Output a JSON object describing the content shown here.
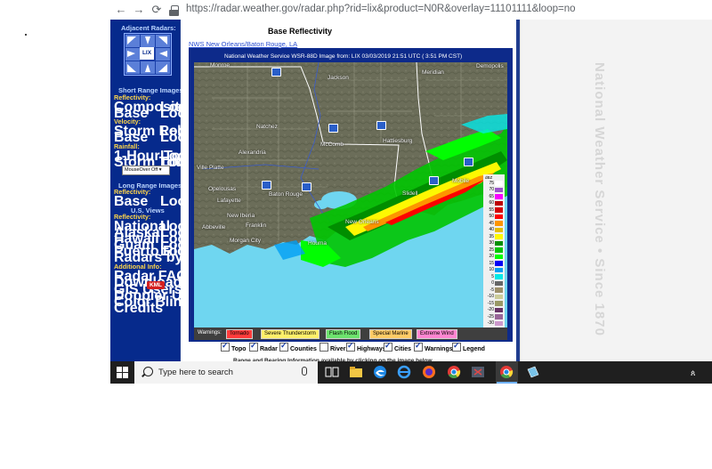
{
  "browser": {
    "url": "https://radar.weather.gov/radar.php?rid=lix&product=N0R&overlay=11101111&loop=no",
    "icons": [
      "back-arrow-icon",
      "forward-arrow-icon",
      "reload-icon",
      "lock-icon"
    ]
  },
  "sidebar": {
    "adjacent_radars_title": "Adjacent Radars:",
    "radar_center_label": "LIX",
    "short_range_title": "Short Range Images",
    "reflectivity": "Reflectivity:",
    "composite": "Composite",
    "base": "Base",
    "loop": "Loop",
    "velocity": "Velocity:",
    "storm_relative": "Storm Relative",
    "rainfall": "Rainfall:",
    "one_hour_total": "1-Hour Total",
    "storm_total": "Storm Total",
    "mouseover_select": "MouseOver Off",
    "long_range_title": "Long Range Images",
    "us_views_title": "U.S. Views",
    "national": "National",
    "alaska": "Alaska",
    "hawaii": "Hawaii",
    "guam": "Guam",
    "puerto_rico": "Puerto Rico",
    "radars_by_state": "Radars by State",
    "additional_info": "Additional Info:",
    "radar_faq": "Radar FAQ",
    "downloading_images": "Downloading Images",
    "gis_users": "GIS Users",
    "kml_badge": "KML",
    "doppler_university": "Doppler University",
    "color_blindness_tool": "Color Blindness Tool",
    "credits": "Credits"
  },
  "main": {
    "page_title": "Base Reflectivity",
    "office_link": "NWS New Orleans/Baton Rouge, LA",
    "image_header": "National Weather Service WSR-88D Image  from:  LIX 03/03/2019  21:51  UTC ( 3:51 PM CST)",
    "side_watermark": "National Weather Service • Since 1870",
    "bottom_clip": "Range and Bearing Information available by clicking on the image below"
  },
  "map": {
    "cities": [
      "Monroe",
      "Jackson",
      "Meridian",
      "Demopolis",
      "Natchez",
      "McComb",
      "Hattiesburg",
      "Alexandria",
      "Ville Platte",
      "Opelousas",
      "Lafayette",
      "Baton Rouge",
      "Slidell",
      "Mobile",
      "New Orleans",
      "New Iberia",
      "Franklin",
      "Abbeville",
      "Morgan City",
      "Houma"
    ],
    "highway_shields": [
      "interstate-shield",
      "interstate-shield",
      "interstate-shield",
      "interstate-shield",
      "interstate-shield",
      "interstate-shield",
      "interstate-shield"
    ]
  },
  "legend": {
    "units": "dBZ",
    "no_data": "ND",
    "levels": [
      {
        "value": "75",
        "color": "#ffffff"
      },
      {
        "value": "70",
        "color": "#9a55c8"
      },
      {
        "value": "65",
        "color": "#f800fd"
      },
      {
        "value": "60",
        "color": "#bc0000"
      },
      {
        "value": "55",
        "color": "#d40000"
      },
      {
        "value": "50",
        "color": "#fd0000"
      },
      {
        "value": "45",
        "color": "#fd9500"
      },
      {
        "value": "40",
        "color": "#e5bc00"
      },
      {
        "value": "35",
        "color": "#fdf802"
      },
      {
        "value": "30",
        "color": "#008e00"
      },
      {
        "value": "25",
        "color": "#01c501"
      },
      {
        "value": "20",
        "color": "#02fd02"
      },
      {
        "value": "15",
        "color": "#0300f4"
      },
      {
        "value": "10",
        "color": "#019ff4"
      },
      {
        "value": "5",
        "color": "#04e9e7"
      },
      {
        "value": "0",
        "color": "#666666"
      },
      {
        "value": "-5",
        "color": "#9c8f6a"
      },
      {
        "value": "-10",
        "color": "#cccc99"
      },
      {
        "value": "-15",
        "color": "#999966"
      },
      {
        "value": "-20",
        "color": "#663366"
      },
      {
        "value": "-25",
        "color": "#996699"
      },
      {
        "value": "-30",
        "color": "#cc99cc"
      }
    ]
  },
  "warnings": {
    "label": "Warnings:",
    "items": [
      {
        "label": "Tornado",
        "color": "#ff3b3b"
      },
      {
        "label": "Severe Thunderstorm",
        "color": "#fff06a"
      },
      {
        "label": "Flash Flood",
        "color": "#6de36d"
      },
      {
        "label": "Special Marine",
        "color": "#ffcc66"
      },
      {
        "label": "Extreme Wind",
        "color": "#ff86d1"
      }
    ]
  },
  "overlays": [
    {
      "label": "Topo",
      "checked": true
    },
    {
      "label": "Radar",
      "checked": true
    },
    {
      "label": "Counties",
      "checked": true
    },
    {
      "label": "Rivers",
      "checked": false
    },
    {
      "label": "Highways",
      "checked": true
    },
    {
      "label": "Cities",
      "checked": true
    },
    {
      "label": "Warnings",
      "checked": true
    },
    {
      "label": "Legend",
      "checked": true
    }
  ],
  "taskbar": {
    "search_placeholder": "Type here to search",
    "tray_icon": "people-icon",
    "apps": [
      "task-view-icon",
      "file-explorer-icon",
      "edge-icon",
      "ie-icon",
      "firefox-icon",
      "chrome-icon",
      "chrome-icon",
      "snipping-tool-icon",
      "chrome-active-icon",
      "notepad-icon"
    ]
  }
}
